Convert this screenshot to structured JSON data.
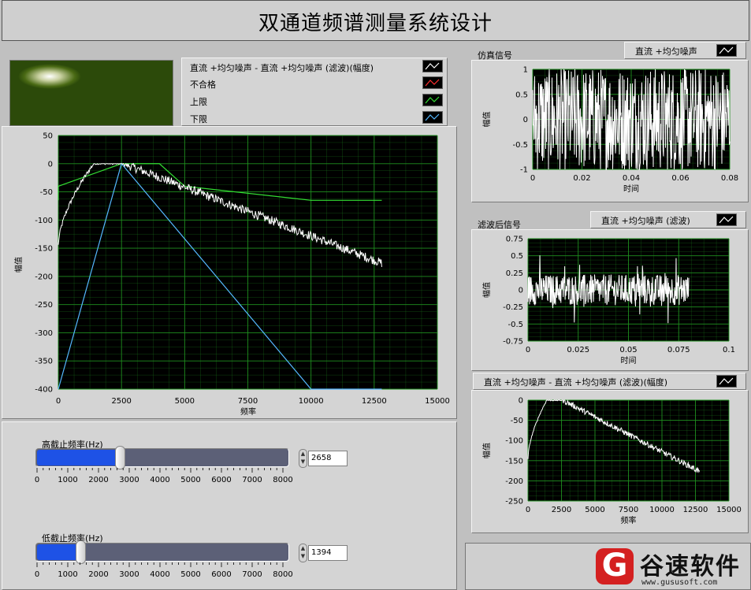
{
  "title": "双通道频谱测量系统设计",
  "legend_main": {
    "items": [
      {
        "label": "直流 +均匀噪声 - 直流 +均匀噪声 (滤波)(幅度)",
        "color": "#ffffff"
      },
      {
        "label": "不合格",
        "color": "#ff3030"
      },
      {
        "label": "上限",
        "color": "#33dd33"
      },
      {
        "label": "下限",
        "color": "#55b8ff"
      }
    ]
  },
  "main_graph": {
    "ylabel": "幅值",
    "xlabel": "频率",
    "yticks": [
      "50",
      "0",
      "-50",
      "-100",
      "-150",
      "-200",
      "-250",
      "-300",
      "-350",
      "-400"
    ],
    "xticks": [
      "0",
      "2500",
      "5000",
      "7500",
      "10000",
      "12500",
      "15000"
    ]
  },
  "sim_graph": {
    "caption": "仿真信号",
    "legend": "直流 +均匀噪声",
    "ylabel": "幅值",
    "xlabel": "时间",
    "yticks": [
      "1",
      "0.5",
      "0",
      "-0.5",
      "-1"
    ],
    "xticks": [
      "0",
      "0.02",
      "0.04",
      "0.06",
      "0.08"
    ]
  },
  "filt_graph": {
    "caption": "滤波后信号",
    "legend": "直流 +均匀噪声 (滤波)",
    "ylabel": "幅值",
    "xlabel": "时间",
    "yticks": [
      "0.75",
      "0.5",
      "0.25",
      "0",
      "-0.25",
      "-0.5",
      "-0.75"
    ],
    "xticks": [
      "0",
      "0.025",
      "0.05",
      "0.075",
      "0.1"
    ]
  },
  "spec_graph": {
    "legend": "直流 +均匀噪声 - 直流 +均匀噪声 (滤波)(幅度)",
    "ylabel": "幅值",
    "xlabel": "频率",
    "yticks": [
      "0",
      "-50",
      "-100",
      "-150",
      "-200",
      "-250"
    ],
    "xticks": [
      "0",
      "2500",
      "5000",
      "7500",
      "10000",
      "12500",
      "15000"
    ]
  },
  "high_cutoff": {
    "label": "高截止频率(Hz)",
    "value": "2658",
    "fraction": 0.332,
    "ticks": [
      "0",
      "1000",
      "2000",
      "3000",
      "4000",
      "5000",
      "6000",
      "7000",
      "8000"
    ]
  },
  "low_cutoff": {
    "label": "低截止频率(Hz)",
    "value": "1394",
    "fraction": 0.174,
    "ticks": [
      "0",
      "1000",
      "2000",
      "3000",
      "4000",
      "5000",
      "6000",
      "7000",
      "8000"
    ]
  },
  "watermark": {
    "brand": "谷速软件",
    "url": "www.gususoft.com"
  },
  "colors": {
    "plot_bg": "#000000",
    "grid": "#1f8f1f",
    "slider_fill": "#1e52e6",
    "slider_track": "#5c6077",
    "led": "#2c4a0a"
  }
}
